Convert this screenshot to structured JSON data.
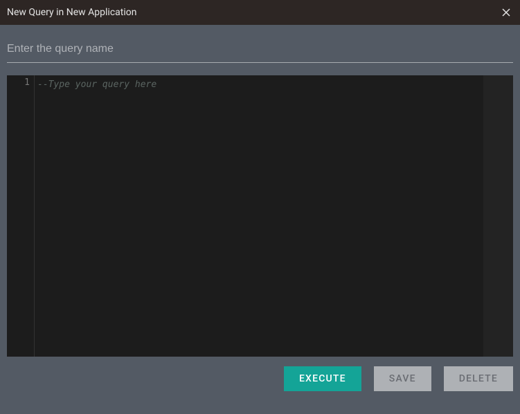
{
  "titlebar": {
    "title": "New Query in New Application"
  },
  "queryName": {
    "placeholder": "Enter the query name",
    "value": ""
  },
  "editor": {
    "lineNumber": "1",
    "placeholder": "--Type your query here"
  },
  "buttons": {
    "execute": "EXECUTE",
    "save": "SAVE",
    "delete": "DELETE"
  }
}
